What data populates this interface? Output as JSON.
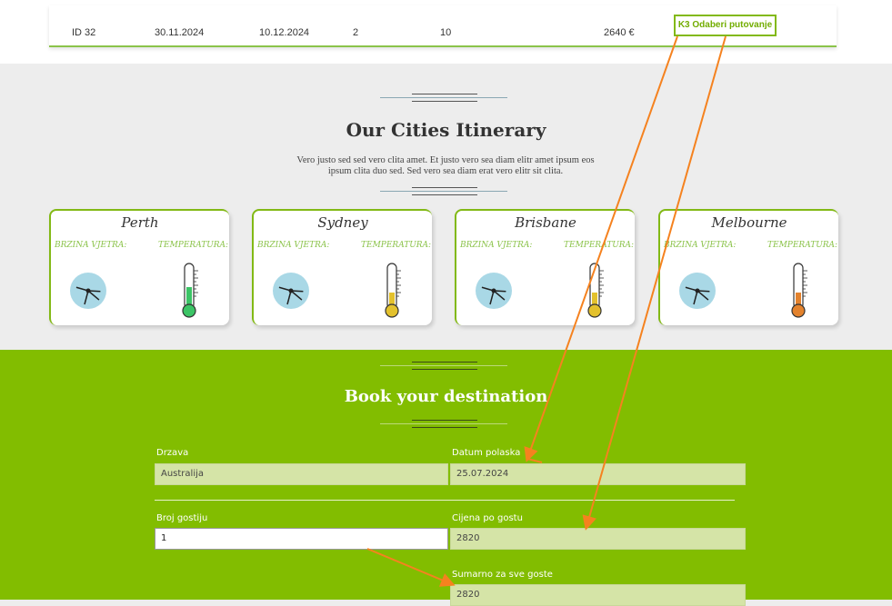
{
  "table_row": {
    "id": "ID 32",
    "date_from": "30.11.2024",
    "date_to": "10.12.2024",
    "col4": "2",
    "col5": "10",
    "price": "2640 €",
    "select_button": "K3 Odaberi putovanje"
  },
  "itinerary": {
    "title": "Our Cities Itinerary",
    "description_line1": "Vero justo sed sed vero clita amet. Et justo vero sea diam elitr amet ipsum eos",
    "description_line2": "ipsum clita duo sed. Sed vero sea diam erat vero elitr sit clita."
  },
  "cities": [
    {
      "name": "Perth",
      "wind_label": "BRZINA VJETRA:",
      "temp_label": "TEMPERATURA:",
      "thermo_color": "#3cc466",
      "thermo_level": 0.55
    },
    {
      "name": "Sydney",
      "wind_label": "BRZINA VJETRA:",
      "temp_label": "TEMPERATURA:",
      "thermo_color": "#e3c12d",
      "thermo_level": 0.4
    },
    {
      "name": "Brisbane",
      "wind_label": "BRZINA VJETRA:",
      "temp_label": "TEMPERATURA:",
      "thermo_color": "#e3c12d",
      "thermo_level": 0.4
    },
    {
      "name": "Melbourne",
      "wind_label": "BRZINA VJETRA:",
      "temp_label": "TEMPERATURA:",
      "thermo_color": "#e3822d",
      "thermo_level": 0.4
    }
  ],
  "booking": {
    "title": "Book your destination",
    "drzava_label": "Drzava",
    "drzava_value": "Australija",
    "datum_label": "Datum polaska",
    "datum_value": "25.07.2024",
    "gosti_label": "Broj gostiju",
    "gosti_value": "1",
    "cijena_label": "Cijena po gostu",
    "cijena_value": "2820",
    "sumarno_label": "Sumarno za sve goste",
    "sumarno_value": "2820"
  },
  "colors": {
    "accent_green": "#82bd00",
    "annotation_arrow": "#f5821f"
  }
}
